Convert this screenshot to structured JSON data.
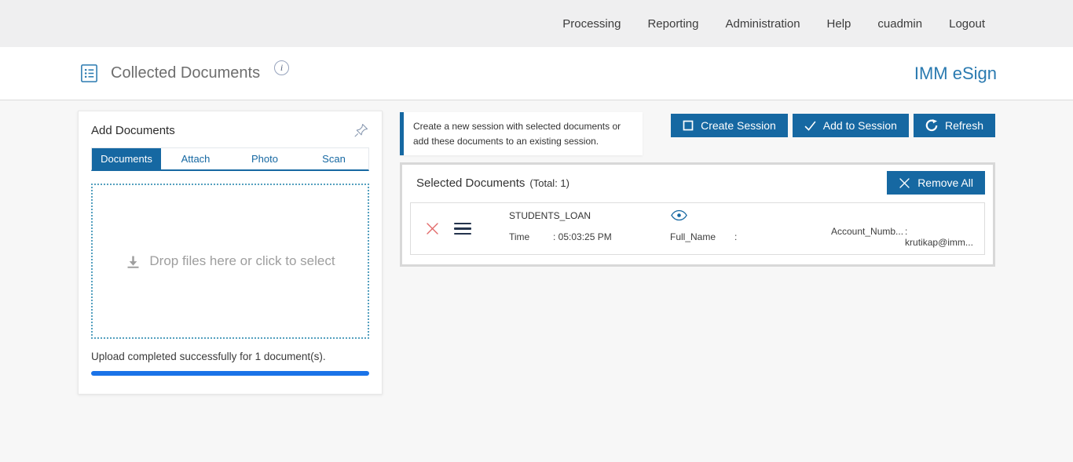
{
  "colors": {
    "accent_blue": "#1668a2",
    "brand_blue": "#2a7ab0",
    "progress_blue": "#1a73e8",
    "dropzone_border": "#55a0bf",
    "remove_red": "#e26a6a",
    "topnav_bg": "#efeff0",
    "page_bg": "#f7f7f7",
    "muted_text": "#9e9e9e"
  },
  "icons": {
    "title_icon": "document-list-icon",
    "info_icon": "circled-i",
    "pin_icon": "pushpin",
    "dropzone_icon": "download-arrow",
    "create_session_icon": "square-outline",
    "add_session_icon": "checkmark",
    "refresh_icon": "circular-arrow",
    "remove_all_icon": "x-cross",
    "row_remove_icon": "red-x",
    "row_drag_icon": "hamburger-lines",
    "row_preview_icon": "eye"
  },
  "nav": {
    "items": [
      "Processing",
      "Reporting",
      "Administration",
      "Help",
      "cuadmin",
      "Logout"
    ]
  },
  "header": {
    "title": "Collected Documents",
    "info_glyph": "i",
    "brand": "IMM eSign"
  },
  "add_documents": {
    "title": "Add Documents",
    "tabs": [
      {
        "label": "Documents"
      },
      {
        "label": "Attach"
      },
      {
        "label": "Photo"
      },
      {
        "label": "Scan"
      }
    ],
    "dropzone_text": "Drop files here or click to select",
    "status_text": "Upload completed successfully for 1 document(s)."
  },
  "session": {
    "info_text": "Create a new session with selected documents or add these documents to an existing session.",
    "create_button": "Create Session",
    "add_button": "Add to Session",
    "refresh_button": "Refresh"
  },
  "selected_documents": {
    "title": "Selected Documents",
    "total": "(Total: 1)",
    "remove_all": "Remove All",
    "row": {
      "name": "STUDENTS_LOAN",
      "time_label": "Time",
      "time_value": ": 05:03:25 PM",
      "fullname_label": "Full_Name",
      "fullname_value": ":",
      "account_label": "Account_Numb...",
      "account_value": ": krutikap@imm..."
    }
  }
}
